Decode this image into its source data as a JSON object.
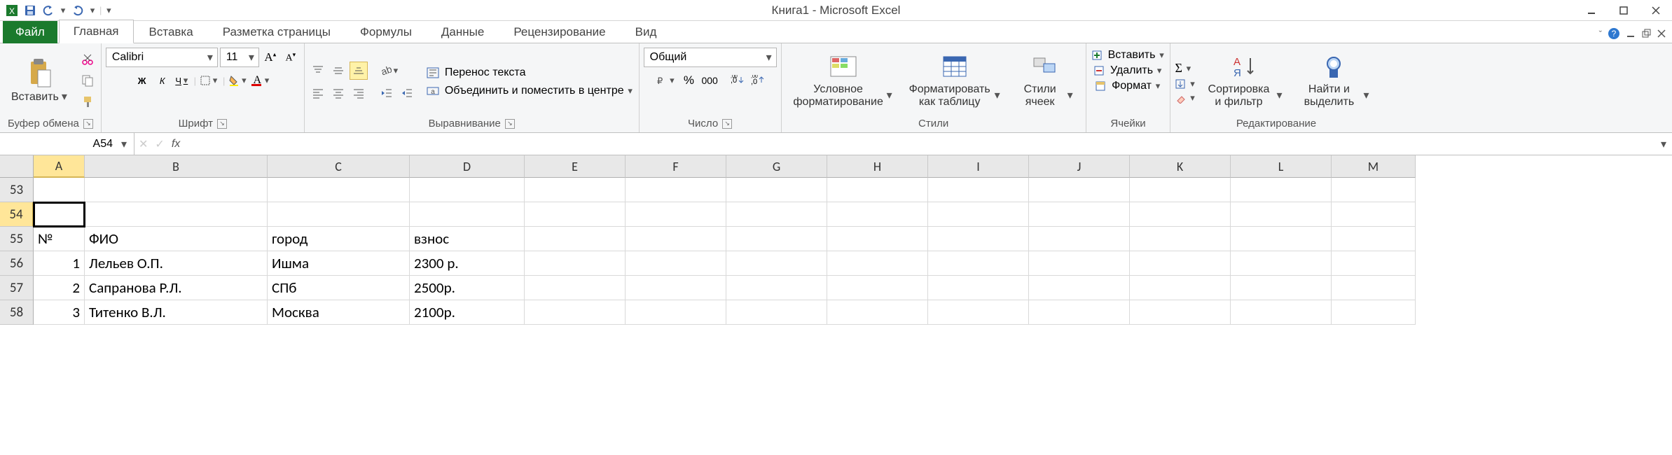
{
  "title": "Книга1 - Microsoft Excel",
  "qat": {
    "save": "save",
    "undo": "undo",
    "redo": "redo"
  },
  "tabs": {
    "file": "Файл",
    "items": [
      "Главная",
      "Вставка",
      "Разметка страницы",
      "Формулы",
      "Данные",
      "Рецензирование",
      "Вид"
    ],
    "active": 0
  },
  "groups": {
    "clipboard": {
      "label": "Буфер обмена",
      "paste": "Вставить"
    },
    "font": {
      "label": "Шрифт",
      "font_name": "Calibri",
      "font_size": "11",
      "bold": "Ж",
      "italic": "К",
      "underline": "Ч"
    },
    "alignment": {
      "label": "Выравнивание",
      "wrap": "Перенос текста",
      "merge": "Объединить и поместить в центре"
    },
    "number": {
      "label": "Число",
      "format": "Общий",
      "percent": "%",
      "thousands": "000"
    },
    "styles": {
      "label": "Стили",
      "cond": "Условное форматирование",
      "table": "Форматировать как таблицу",
      "cell": "Стили ячеек"
    },
    "cells": {
      "label": "Ячейки",
      "insert": "Вставить",
      "delete": "Удалить",
      "format": "Формат"
    },
    "editing": {
      "label": "Редактирование",
      "sort": "Сортировка и фильтр",
      "find": "Найти и выделить"
    }
  },
  "formula_bar": {
    "name_box": "A54",
    "fx": "fx",
    "value": ""
  },
  "columns": [
    "A",
    "B",
    "C",
    "D",
    "E",
    "F",
    "G",
    "H",
    "I",
    "J",
    "K",
    "L",
    "M"
  ],
  "rows": {
    "53": {
      "A": "",
      "B": "",
      "C": "",
      "D": ""
    },
    "54": {
      "A": "",
      "B": "",
      "C": "",
      "D": ""
    },
    "55": {
      "A": "№",
      "B": "ФИО",
      "C": "город",
      "D": "взнос"
    },
    "56": {
      "A": "1",
      "B": "Лельев О.П.",
      "C": "Ишма",
      "D": "2300 р."
    },
    "57": {
      "A": "2",
      "B": "Сапранова Р.Л.",
      "C": "СПб",
      "D": "2500р."
    },
    "58": {
      "A": "3",
      "B": "Титенко В.Л.",
      "C": "Москва",
      "D": "2100р."
    }
  },
  "active_cell": "A54"
}
